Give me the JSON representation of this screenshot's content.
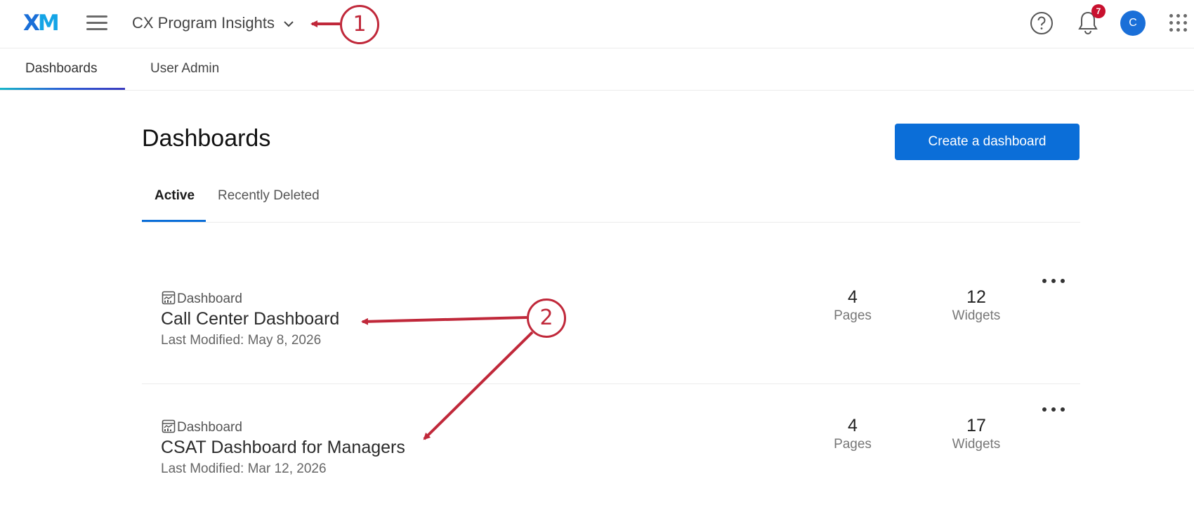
{
  "header": {
    "logo_x": "X",
    "logo_m": "M",
    "project_name": "CX Program Insights",
    "notification_count": "7",
    "avatar_initial": "C"
  },
  "nav": {
    "tabs": [
      {
        "label": "Dashboards",
        "active": true
      },
      {
        "label": "User Admin",
        "active": false
      }
    ]
  },
  "main": {
    "title": "Dashboards",
    "create_button": "Create a dashboard",
    "tabs": [
      {
        "label": "Active",
        "active": true
      },
      {
        "label": "Recently Deleted",
        "active": false
      }
    ],
    "dashboards": [
      {
        "type_label": "Dashboard",
        "name": "Call Center Dashboard",
        "modified": "Last Modified: May 8, 2026",
        "pages": "4",
        "pages_label": "Pages",
        "widgets": "12",
        "widgets_label": "Widgets"
      },
      {
        "type_label": "Dashboard",
        "name": "CSAT Dashboard for Managers",
        "modified": "Last Modified: Mar 12, 2026",
        "pages": "4",
        "pages_label": "Pages",
        "widgets": "17",
        "widgets_label": "Widgets"
      }
    ]
  },
  "annotations": {
    "callout_1": "1",
    "callout_2": "2",
    "color": "#c0283a"
  },
  "colors": {
    "primary": "#0b6ed8",
    "badge": "#c8102e"
  },
  "icons": [
    "hamburger-icon",
    "chevron-down-icon",
    "help-icon",
    "bell-icon",
    "apps-grid-icon",
    "dashboard-icon",
    "more-options-icon"
  ]
}
